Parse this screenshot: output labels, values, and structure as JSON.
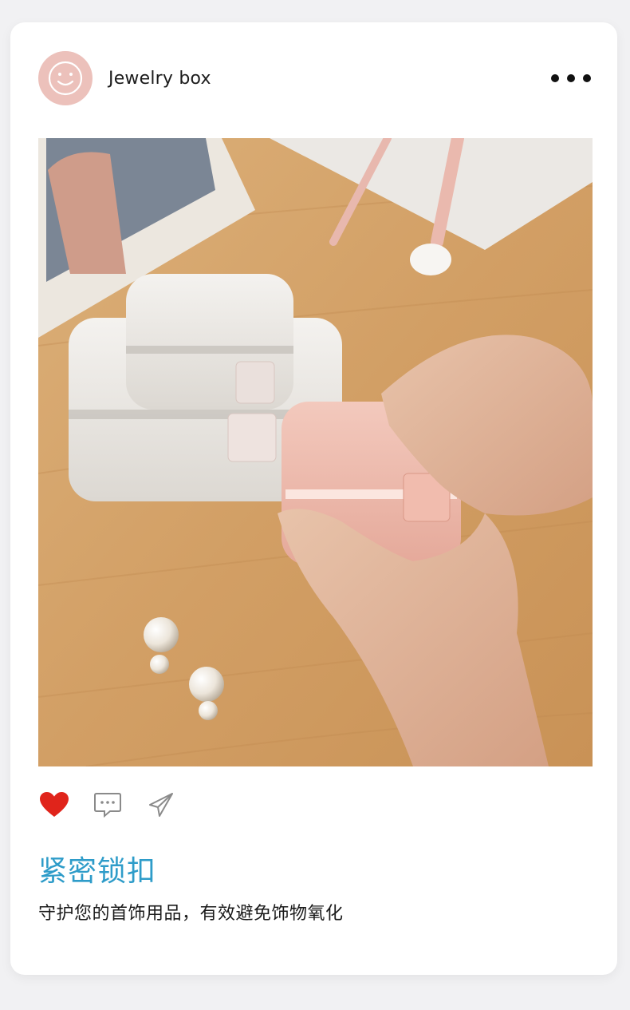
{
  "post": {
    "username": "Jewelry box",
    "avatar_icon": "smiley-face-icon",
    "avatar_color": "#ecc1bb",
    "more_icon": "more-horizontal-icon",
    "image_alt": "pink jewelry box held in hands on wooden table",
    "liked": true,
    "like_color": "#e0241b",
    "title": "紧密锁扣",
    "title_color": "#2e9cc9",
    "description": "守护您的首饰用品，有效避免饰物氧化"
  },
  "actions": [
    {
      "icon": "heart-icon"
    },
    {
      "icon": "comment-icon"
    },
    {
      "icon": "share-icon"
    }
  ]
}
